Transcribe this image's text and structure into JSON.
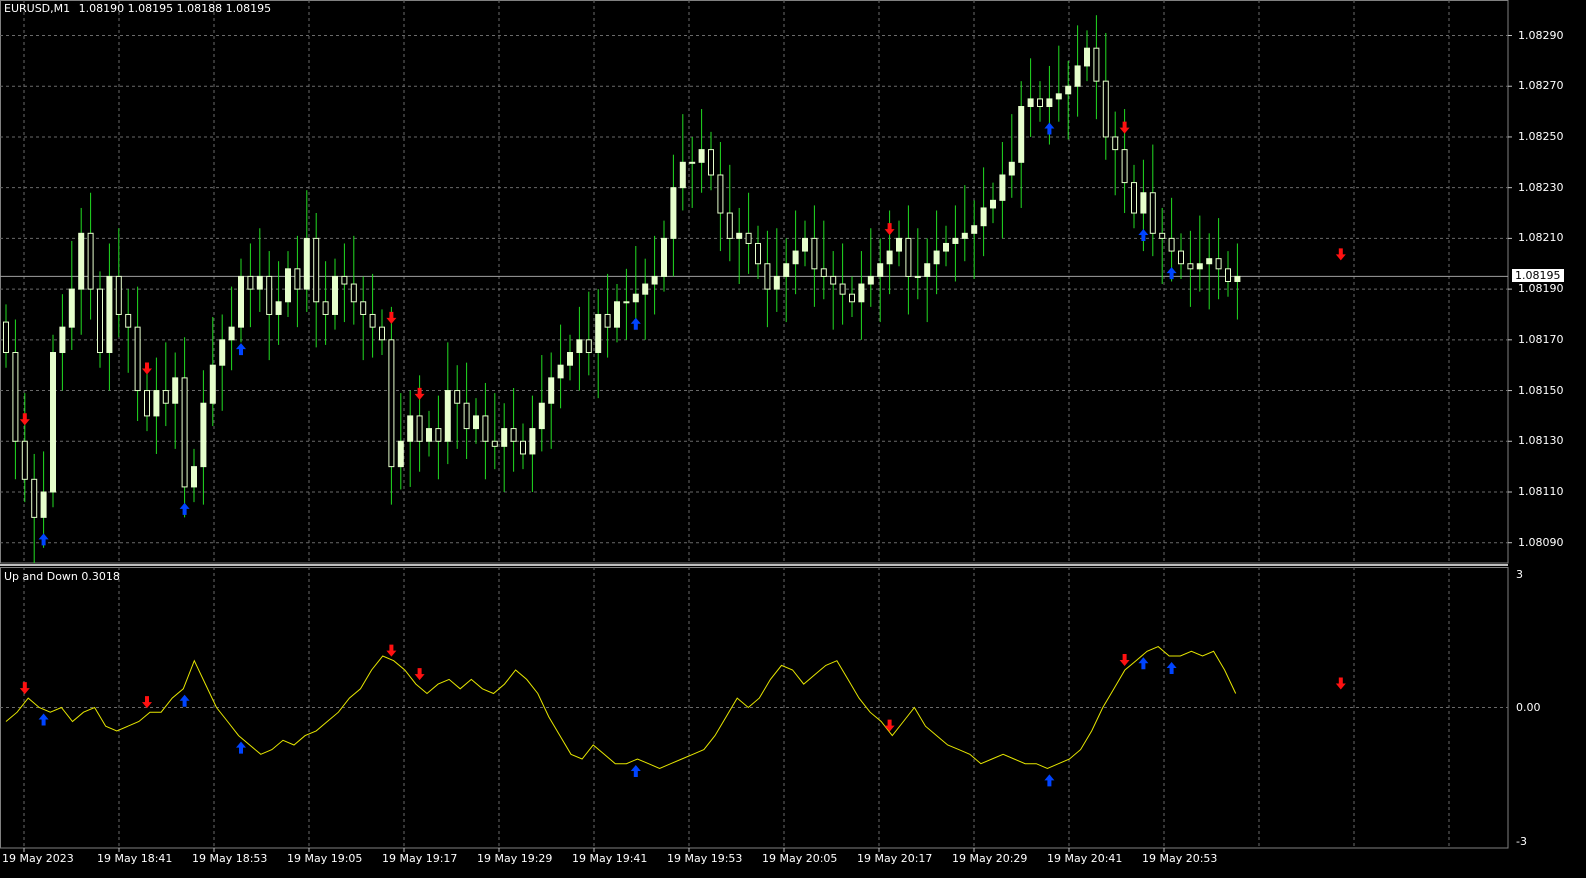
{
  "header": {
    "symbol": "EURUSD,M1",
    "ohlc": "1.08190 1.08195 1.08188 1.08195"
  },
  "indicator": {
    "label": "Up and Down 0.3018"
  },
  "colors": {
    "background": "#000000",
    "grid": "#6a6a6a",
    "bull_candle": "#e6ffcc",
    "wick": "#22dd22",
    "indicator_line": "#e6e600",
    "up_arrow": "#0044ff",
    "down_arrow": "#ff1111",
    "current_price_line": "#a0a0a0"
  },
  "chart_data": [
    {
      "type": "candlestick",
      "title": "EURUSD,M1",
      "ylim": [
        1.08082,
        1.08304
      ],
      "y_ticks": [
        "1.08290",
        "1.08270",
        "1.08250",
        "1.08230",
        "1.08210",
        "1.08190",
        "1.08170",
        "1.08150",
        "1.08130",
        "1.08110",
        "1.08090"
      ],
      "current_price": "1.08195",
      "x_tick_labels": [
        "19 May 2023",
        "19 May 18:41",
        "19 May 18:53",
        "19 May 19:05",
        "19 May 19:17",
        "19 May 19:29",
        "19 May 19:41",
        "19 May 19:53",
        "19 May 20:05",
        "19 May 20:17",
        "19 May 20:29",
        "19 May 20:41",
        "19 May 20:53"
      ],
      "close": [
        1.08165,
        1.0813,
        1.08115,
        1.081,
        1.0811,
        1.08165,
        1.08175,
        1.0819,
        1.08212,
        1.0819,
        1.08165,
        1.08195,
        1.0818,
        1.08175,
        1.0815,
        1.0814,
        1.0815,
        1.08145,
        1.08155,
        1.08112,
        1.0812,
        1.08145,
        1.0816,
        1.0817,
        1.08175,
        1.08195,
        1.0819,
        1.08195,
        1.0818,
        1.08185,
        1.08198,
        1.0819,
        1.0821,
        1.08185,
        1.0818,
        1.08195,
        1.08192,
        1.08185,
        1.0818,
        1.08175,
        1.0817,
        1.0812,
        1.0813,
        1.0814,
        1.0813,
        1.08135,
        1.0813,
        1.0815,
        1.08145,
        1.08135,
        1.0814,
        1.0813,
        1.08128,
        1.08135,
        1.0813,
        1.08125,
        1.08135,
        1.08145,
        1.08155,
        1.0816,
        1.08165,
        1.0817,
        1.08165,
        1.0818,
        1.08175,
        1.08185,
        1.08185,
        1.08188,
        1.08192,
        1.08195,
        1.0821,
        1.0823,
        1.0824,
        1.0824,
        1.08245,
        1.08235,
        1.0822,
        1.0821,
        1.08212,
        1.08208,
        1.082,
        1.0819,
        1.08195,
        1.082,
        1.08205,
        1.0821,
        1.08198,
        1.08195,
        1.08192,
        1.08188,
        1.08185,
        1.08192,
        1.08195,
        1.082,
        1.08205,
        1.0821,
        1.08195,
        1.08195,
        1.082,
        1.08205,
        1.08208,
        1.0821,
        1.08212,
        1.08215,
        1.08222,
        1.08225,
        1.08235,
        1.0824,
        1.08262,
        1.08265,
        1.08262,
        1.08265,
        1.08267,
        1.0827,
        1.08278,
        1.08285,
        1.08272,
        1.0825,
        1.08245,
        1.08232,
        1.0822,
        1.08228,
        1.08212,
        1.0821,
        1.08205,
        1.082,
        1.08198,
        1.082,
        1.08202,
        1.08198,
        1.08193,
        1.08195
      ]
    },
    {
      "type": "line",
      "title": "Up and Down 0.3018",
      "ylim": [
        -3,
        3
      ],
      "y_ticks": [
        "3",
        "0.00",
        "-3"
      ],
      "values": [
        -0.3,
        -0.1,
        0.2,
        0.0,
        -0.1,
        0.0,
        -0.3,
        -0.1,
        0.0,
        -0.4,
        -0.5,
        -0.4,
        -0.3,
        -0.1,
        -0.1,
        0.2,
        0.4,
        1.0,
        0.5,
        0.0,
        -0.3,
        -0.6,
        -0.8,
        -1.0,
        -0.9,
        -0.7,
        -0.8,
        -0.6,
        -0.5,
        -0.3,
        -0.1,
        0.2,
        0.4,
        0.8,
        1.1,
        1.0,
        0.8,
        0.5,
        0.3,
        0.5,
        0.6,
        0.4,
        0.6,
        0.4,
        0.3,
        0.5,
        0.8,
        0.6,
        0.3,
        -0.2,
        -0.6,
        -1.0,
        -1.1,
        -0.8,
        -1.0,
        -1.2,
        -1.2,
        -1.1,
        -1.2,
        -1.3,
        -1.2,
        -1.1,
        -1.0,
        -0.9,
        -0.6,
        -0.2,
        0.2,
        0.0,
        0.2,
        0.6,
        0.9,
        0.8,
        0.5,
        0.7,
        0.9,
        1.0,
        0.6,
        0.2,
        -0.1,
        -0.3,
        -0.6,
        -0.3,
        0.0,
        -0.4,
        -0.6,
        -0.8,
        -0.9,
        -1.0,
        -1.2,
        -1.1,
        -1.0,
        -1.1,
        -1.2,
        -1.2,
        -1.3,
        -1.2,
        -1.1,
        -0.9,
        -0.5,
        0.0,
        0.4,
        0.8,
        1.0,
        1.2,
        1.3,
        1.1,
        1.1,
        1.2,
        1.1,
        1.2,
        0.8,
        0.3
      ],
      "up_arrow_bars": [
        4,
        19,
        25,
        67,
        111,
        121,
        124
      ],
      "down_arrow_bars": [
        2,
        15,
        41,
        44,
        94,
        119,
        142
      ]
    }
  ]
}
